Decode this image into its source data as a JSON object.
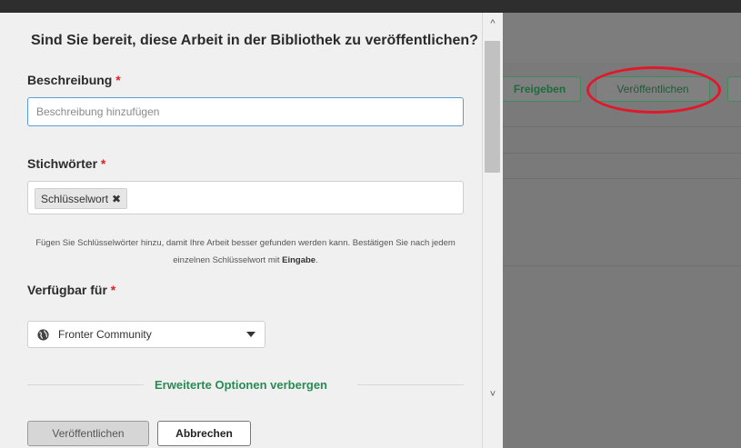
{
  "dialog": {
    "title": "Sind Sie bereit, diese Arbeit in der Bibliothek zu veröffentlichen?",
    "description": {
      "label": "Beschreibung",
      "required_mark": "*",
      "placeholder": "Beschreibung hinzufügen",
      "value": ""
    },
    "keywords": {
      "label": "Stichwörter",
      "required_mark": "*",
      "tags": [
        "Schlüsselwort"
      ],
      "help_text_prefix": "Fügen Sie Schlüsselwörter hinzu, damit Ihre Arbeit besser gefunden werden kann. Bestätigen Sie nach jedem einzelnen Schlüsselwort mit ",
      "help_text_bold": "Eingabe",
      "help_text_suffix": "."
    },
    "availability": {
      "label": "Verfügbar für",
      "required_mark": "*",
      "selected": "Fronter Community",
      "icon": "globe-icon"
    },
    "advanced_toggle": "Erweiterte Optionen verbergen",
    "buttons": {
      "publish": "Veröffentlichen",
      "cancel": "Abbrechen"
    }
  },
  "background": {
    "share_button": "Freigeben",
    "publish_button": "Veröffentlichen",
    "highlight_color": "#e0192a",
    "accent_color": "#2a8a56"
  },
  "scrollbar": {
    "up_arrow": "^",
    "down_arrow": "˅"
  }
}
